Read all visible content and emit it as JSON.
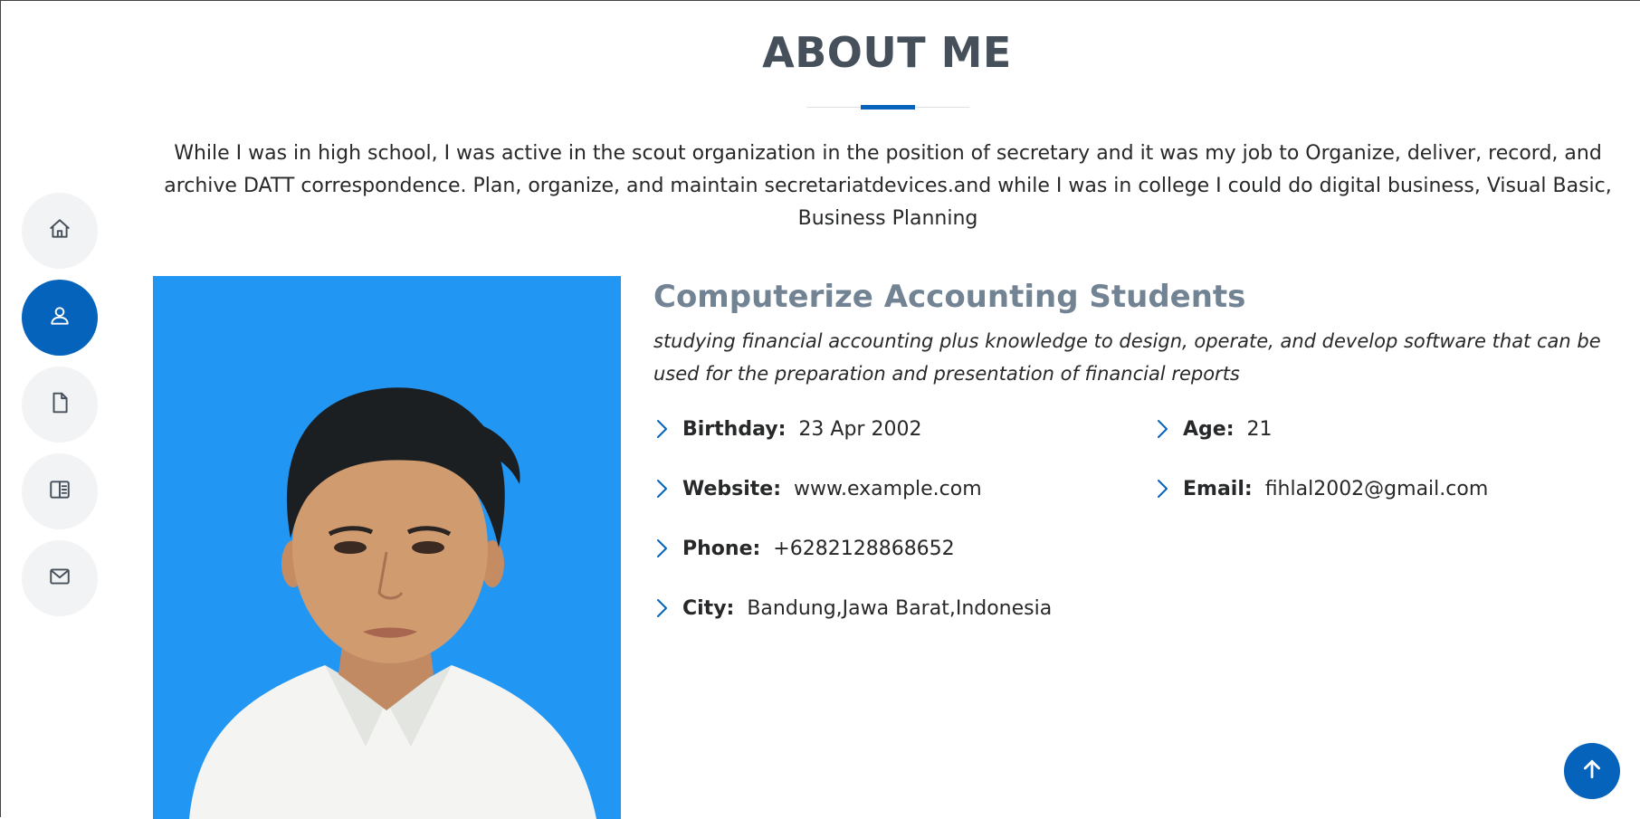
{
  "nav": {
    "items": [
      {
        "icon": "home-icon",
        "active": false
      },
      {
        "icon": "person-icon",
        "active": true
      },
      {
        "icon": "file-icon",
        "active": false
      },
      {
        "icon": "book-icon",
        "active": false
      },
      {
        "icon": "envelope-icon",
        "active": false
      }
    ]
  },
  "section": {
    "title": "ABOUT ME",
    "intro": "While I was in high school, I was active in the scout organization in the position of secretary and it was my job to Organize, deliver, record, and archive DATT correspondence. Plan, organize, and maintain secretariatdevices.and while I was in college I could do digital business, Visual Basic, Business Planning"
  },
  "profile": {
    "heading": "Computerize Accounting Students",
    "description": "studying financial accounting plus knowledge to design, operate, and develop software that can be used for the preparation and presentation of financial reports",
    "info": {
      "birthday": {
        "label": "Birthday:",
        "value": "23 Apr 2002"
      },
      "age": {
        "label": "Age:",
        "value": "21"
      },
      "website": {
        "label": "Website:",
        "value": "www.example.com"
      },
      "email": {
        "label": "Email:",
        "value": "fihlal2002@gmail.com"
      },
      "phone": {
        "label": "Phone:",
        "value": "+6282128868652"
      },
      "city": {
        "label": "City:",
        "value": "Bandung,Jawa Barat,Indonesia"
      }
    }
  },
  "colors": {
    "accent": "#0563bb",
    "photo_background": "#2196f3",
    "heading": "#45505b",
    "subheading": "#728394"
  },
  "back_to_top": {
    "icon": "arrow-up-icon"
  }
}
